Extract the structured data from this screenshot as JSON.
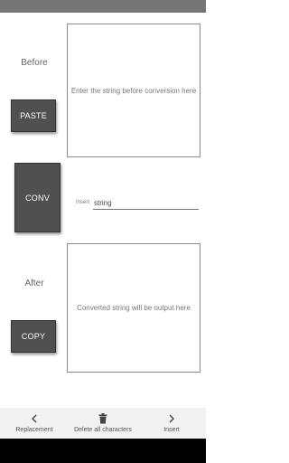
{
  "before_section": {
    "label": "Before",
    "paste_button": "PASTE",
    "placeholder": "Enter the string before conversion here"
  },
  "convert": {
    "button": "CONV",
    "insert_caption": "Insert",
    "insert_value": "string"
  },
  "after_section": {
    "label": "After",
    "copy_button": "COPY",
    "placeholder": "Converted string will be output here"
  },
  "bottom_nav": {
    "replacement": {
      "label": "Replacement",
      "icon": "chevron-left-icon"
    },
    "delete_all": {
      "label": "Delete all characters",
      "icon": "trash-icon"
    },
    "insert": {
      "label": "Insert",
      "icon": "chevron-right-icon"
    }
  },
  "colors": {
    "status_bar": "#757575",
    "button_bg": "#505050",
    "nav_bg": "#f2f2f2"
  }
}
